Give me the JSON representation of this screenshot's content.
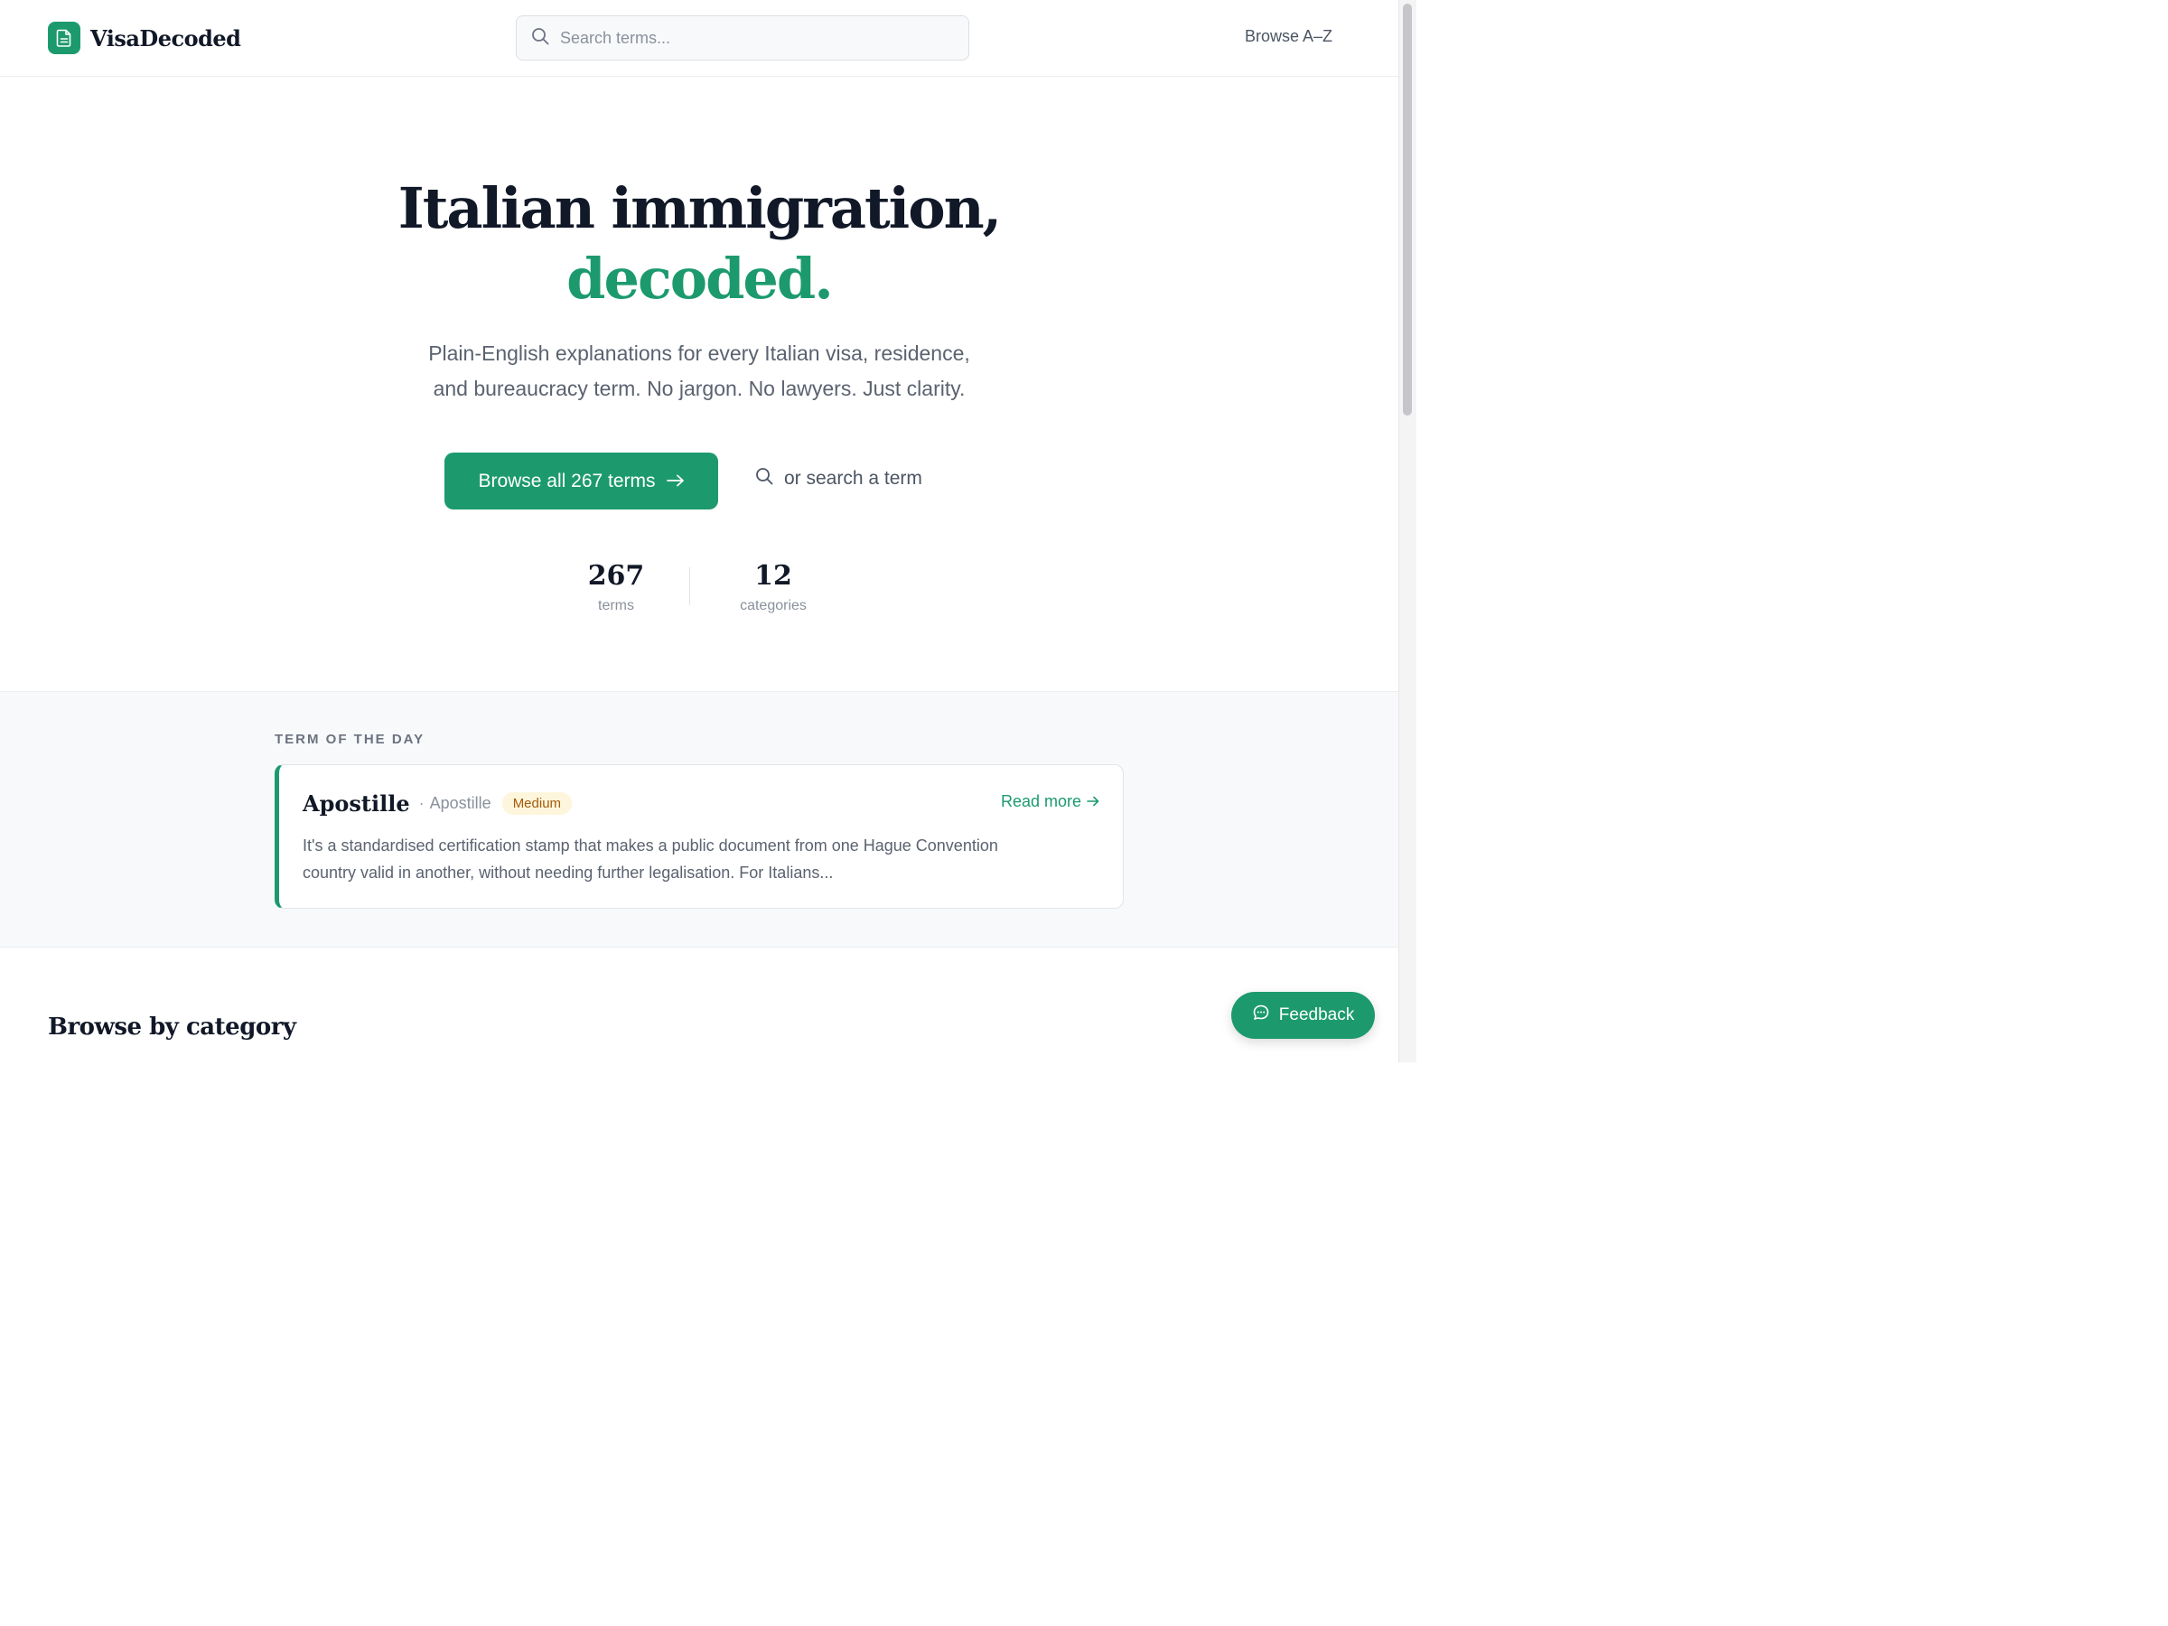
{
  "header": {
    "brand_name": "VisaDecoded",
    "search_placeholder": "Search terms...",
    "nav_link": "Browse A–Z"
  },
  "hero": {
    "title_line1": "Italian immigration,",
    "title_line2": "decoded.",
    "subtitle_line1": "Plain-English explanations for every Italian visa, residence,",
    "subtitle_line2": "and bureaucracy term. No jargon. No lawyers. Just clarity.",
    "cta_label": "Browse all 267 terms",
    "search_link_label": "or search a term"
  },
  "stats": [
    {
      "value": "267",
      "label": "terms"
    },
    {
      "value": "12",
      "label": "categories"
    }
  ],
  "term_of_day": {
    "section_label": "TERM OF THE DAY",
    "name": "Apostille",
    "alt_name": "Apostille",
    "difficulty": "Medium",
    "read_more": "Read more",
    "description": "It's a standardised certification stamp that makes a public document from one Hague Convention country valid in another, without needing further legalisation. For Italians..."
  },
  "browse": {
    "heading": "Browse by category"
  },
  "feedback": {
    "label": "Feedback"
  },
  "colors": {
    "accent": "#1c9a6e",
    "badge_bg": "#fef6dc",
    "badge_text": "#a35a09"
  },
  "icons": {
    "brand": "document-icon",
    "search": "search-icon",
    "arrow": "arrow-right-icon",
    "feedback": "chat-bubble-icon"
  }
}
